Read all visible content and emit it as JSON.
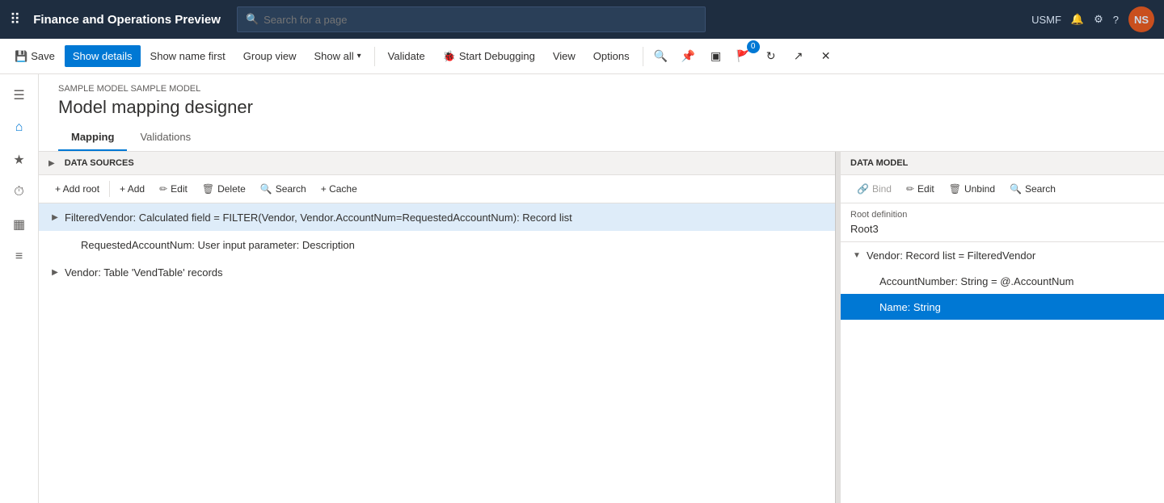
{
  "app": {
    "title": "Finance and Operations Preview",
    "search_placeholder": "Search for a page",
    "env": "USMF",
    "avatar_initials": "NS"
  },
  "command_bar": {
    "save_label": "Save",
    "show_details_label": "Show details",
    "show_name_first_label": "Show name first",
    "group_view_label": "Group view",
    "show_all_label": "Show all",
    "validate_label": "Validate",
    "start_debugging_label": "Start Debugging",
    "view_label": "View",
    "options_label": "Options"
  },
  "breadcrumb": "SAMPLE MODEL SAMPLE MODEL",
  "page_title": "Model mapping designer",
  "tabs": [
    {
      "label": "Mapping",
      "active": true
    },
    {
      "label": "Validations",
      "active": false
    }
  ],
  "data_sources": {
    "title": "DATA SOURCES",
    "toolbar": {
      "add_root_label": "+ Add root",
      "add_label": "+ Add",
      "edit_label": "Edit",
      "delete_label": "Delete",
      "search_label": "Search",
      "cache_label": "+ Cache"
    },
    "items": [
      {
        "text": "FilteredVendor: Calculated field = FILTER(Vendor, Vendor.AccountNum=RequestedAccountNum): Record list",
        "expanded": false,
        "indent": 0,
        "selected": true
      },
      {
        "text": "RequestedAccountNum: User input parameter: Description",
        "expanded": false,
        "indent": 1,
        "selected": false
      },
      {
        "text": "Vendor: Table 'VendTable' records",
        "expanded": false,
        "indent": 0,
        "selected": false
      }
    ]
  },
  "data_model": {
    "title": "DATA MODEL",
    "toolbar": {
      "bind_label": "Bind",
      "edit_label": "Edit",
      "unbind_label": "Unbind",
      "search_label": "Search"
    },
    "root_definition_label": "Root definition",
    "root_value": "Root3",
    "items": [
      {
        "text": "Vendor: Record list = FilteredVendor",
        "expanded": true,
        "indent": 0,
        "selected": false
      },
      {
        "text": "AccountNumber: String = @.AccountNum",
        "expanded": false,
        "indent": 1,
        "selected": false
      },
      {
        "text": "Name: String",
        "expanded": false,
        "indent": 1,
        "selected": true
      }
    ]
  },
  "sidebar_icons": [
    "☰",
    "⌂",
    "★",
    "⏱",
    "▦",
    "≡"
  ],
  "notification_count": "0"
}
